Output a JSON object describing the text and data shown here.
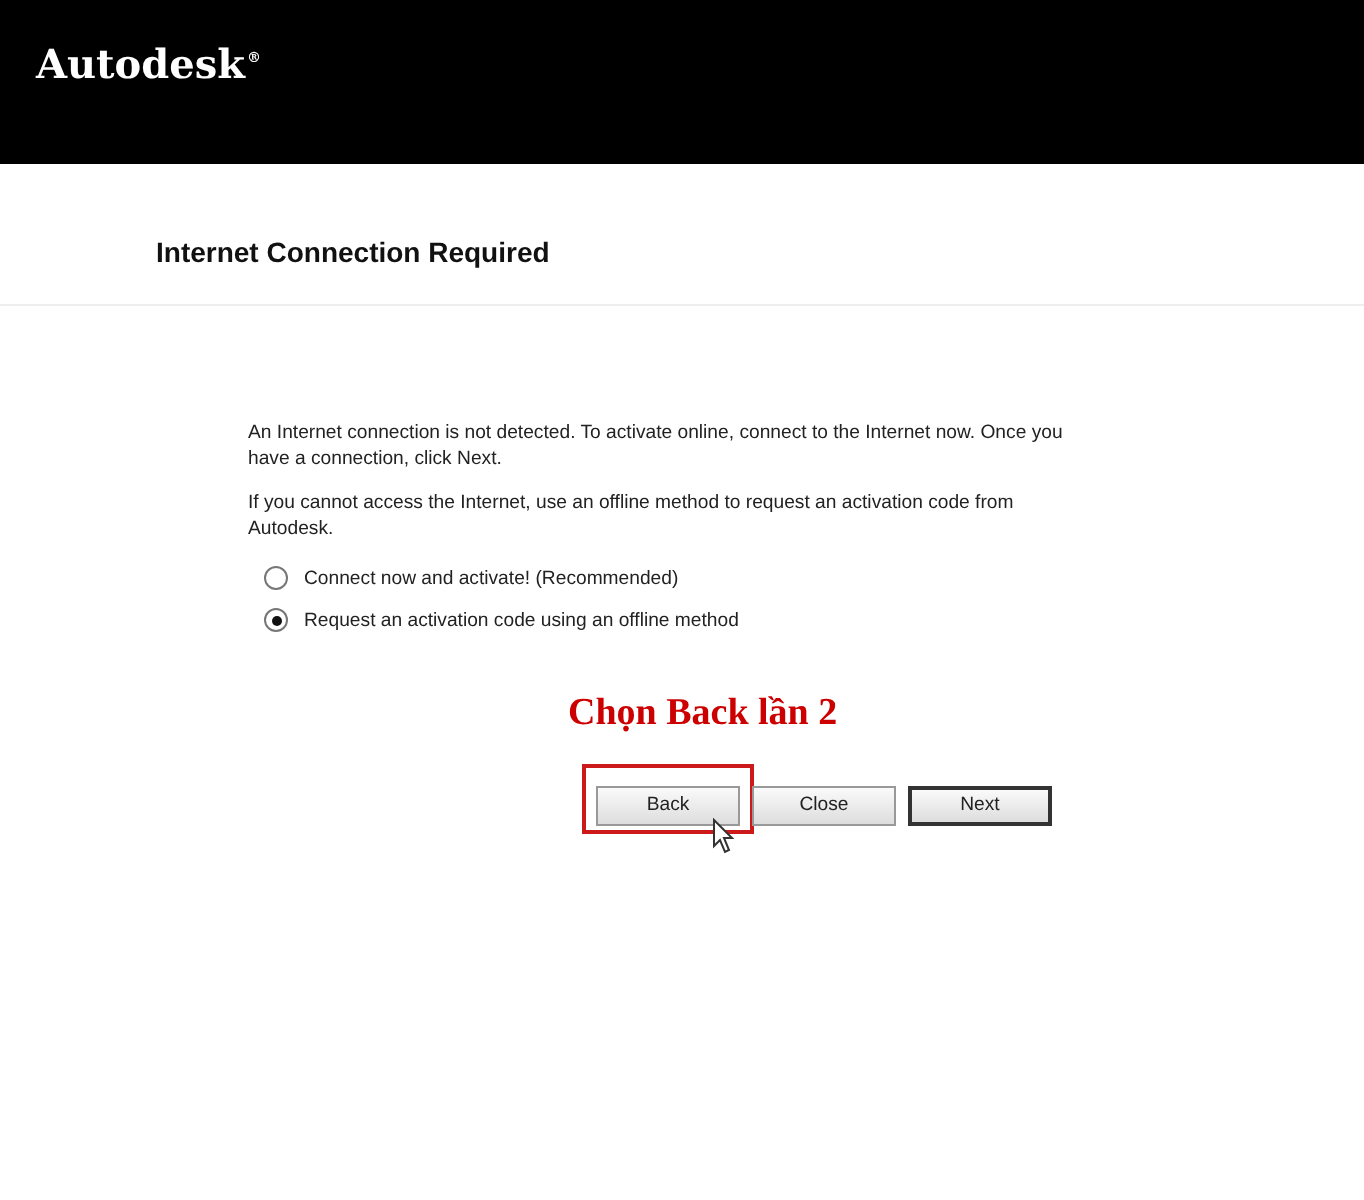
{
  "header": {
    "logo": "Autodesk",
    "logo_mark": "®"
  },
  "title": "Internet Connection Required",
  "paragraphs": [
    "An Internet connection is not detected. To activate online, connect to the Internet now. Once you have a connection, click Next.",
    "If you cannot access the Internet, use an offline method to request an activation code from Autodesk."
  ],
  "options": [
    {
      "label": "Connect now and activate! (Recommended)",
      "selected": false
    },
    {
      "label": "Request an activation code using an offline method",
      "selected": true
    }
  ],
  "annotation": "Chọn Back lần 2",
  "buttons": [
    {
      "label": "Back",
      "default": false,
      "highlighted": true
    },
    {
      "label": "Close",
      "default": false,
      "highlighted": false
    },
    {
      "label": "Next",
      "default": true,
      "highlighted": false
    }
  ]
}
